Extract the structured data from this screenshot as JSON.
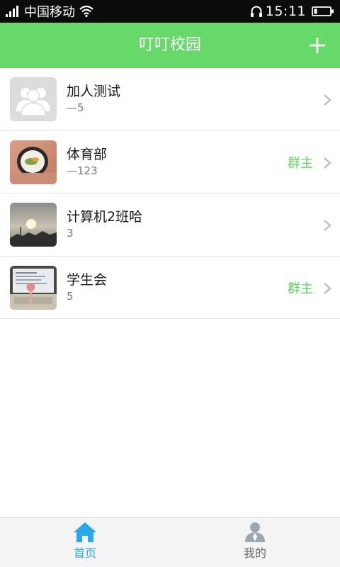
{
  "status_bar": {
    "carrier": "中国移动",
    "time": "15:11"
  },
  "header": {
    "title": "叮叮校园",
    "add_icon": "plus-icon"
  },
  "groups": [
    {
      "name": "加人测试",
      "sub": "—5",
      "badge": "",
      "avatar": "default-group-avatar"
    },
    {
      "name": "体育部",
      "sub": "—123",
      "badge": "群主",
      "avatar": "sushi-photo"
    },
    {
      "name": "计算机2班哈",
      "sub": "3",
      "badge": "",
      "avatar": "sunset-photo"
    },
    {
      "name": "学生会",
      "sub": "5",
      "badge": "群主",
      "avatar": "laptop-photo"
    }
  ],
  "tabs": [
    {
      "label": "首页",
      "icon": "home-icon",
      "active": true
    },
    {
      "label": "我的",
      "icon": "profile-icon",
      "active": false
    }
  ],
  "colors": {
    "header_bg": "#67d86a",
    "badge": "#5fd05f",
    "tab_active": "#2aa7e6",
    "tab_inactive": "#666666"
  }
}
